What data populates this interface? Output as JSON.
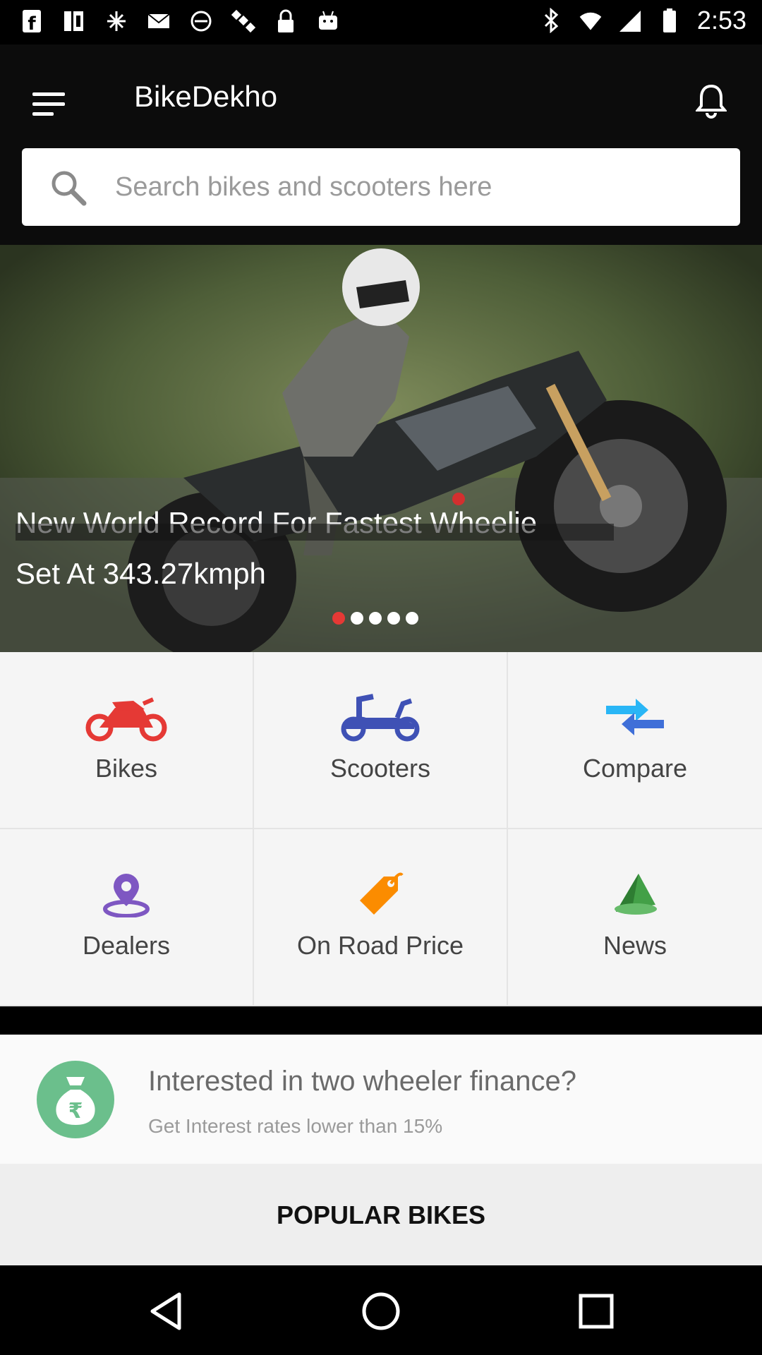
{
  "status_bar": {
    "time": "2:53",
    "left_icons": [
      "facebook-icon",
      "ig-icon",
      "sparkle-icon",
      "mail-icon",
      "blocked-icon",
      "satellite-icon",
      "lock-icon",
      "android-icon"
    ],
    "right_icons": [
      "bluetooth-icon",
      "wifi-icon",
      "signal-icon",
      "battery-icon"
    ]
  },
  "header": {
    "title": "BikeDekho",
    "menu_icon": "menu-icon",
    "notification_icon": "bell-icon"
  },
  "search": {
    "placeholder": "Search bikes and scooters here"
  },
  "banner": {
    "headline_line1": "New World Record For Fastest Wheelie",
    "headline_line2": "Set At 343.27kmph",
    "slides": 5,
    "active_slide": 1
  },
  "categories": [
    {
      "label": "Bikes",
      "icon": "motorbike-icon",
      "color": "#e53935"
    },
    {
      "label": "Scooters",
      "icon": "scooter-icon",
      "color": "#3f51b5"
    },
    {
      "label": "Compare",
      "icon": "compare-arrows-icon",
      "color": "#42a5f5"
    },
    {
      "label": "Dealers",
      "icon": "location-pin-icon",
      "color": "#7e57c2"
    },
    {
      "label": "On Road Price",
      "icon": "price-tag-icon",
      "color": "#fb8c00"
    },
    {
      "label": "News",
      "icon": "megaphone-icon",
      "color": "#43a047"
    }
  ],
  "finance": {
    "title": "Interested in two wheeler finance?",
    "subtitle": "Get Interest rates lower than 15%",
    "icon": "money-bag-rupee-icon",
    "icon_symbol": "₹"
  },
  "popular": {
    "label": "POPULAR BIKES"
  },
  "nav": {
    "back_icon": "back-icon",
    "home_icon": "home-icon",
    "recents_icon": "recents-icon"
  }
}
